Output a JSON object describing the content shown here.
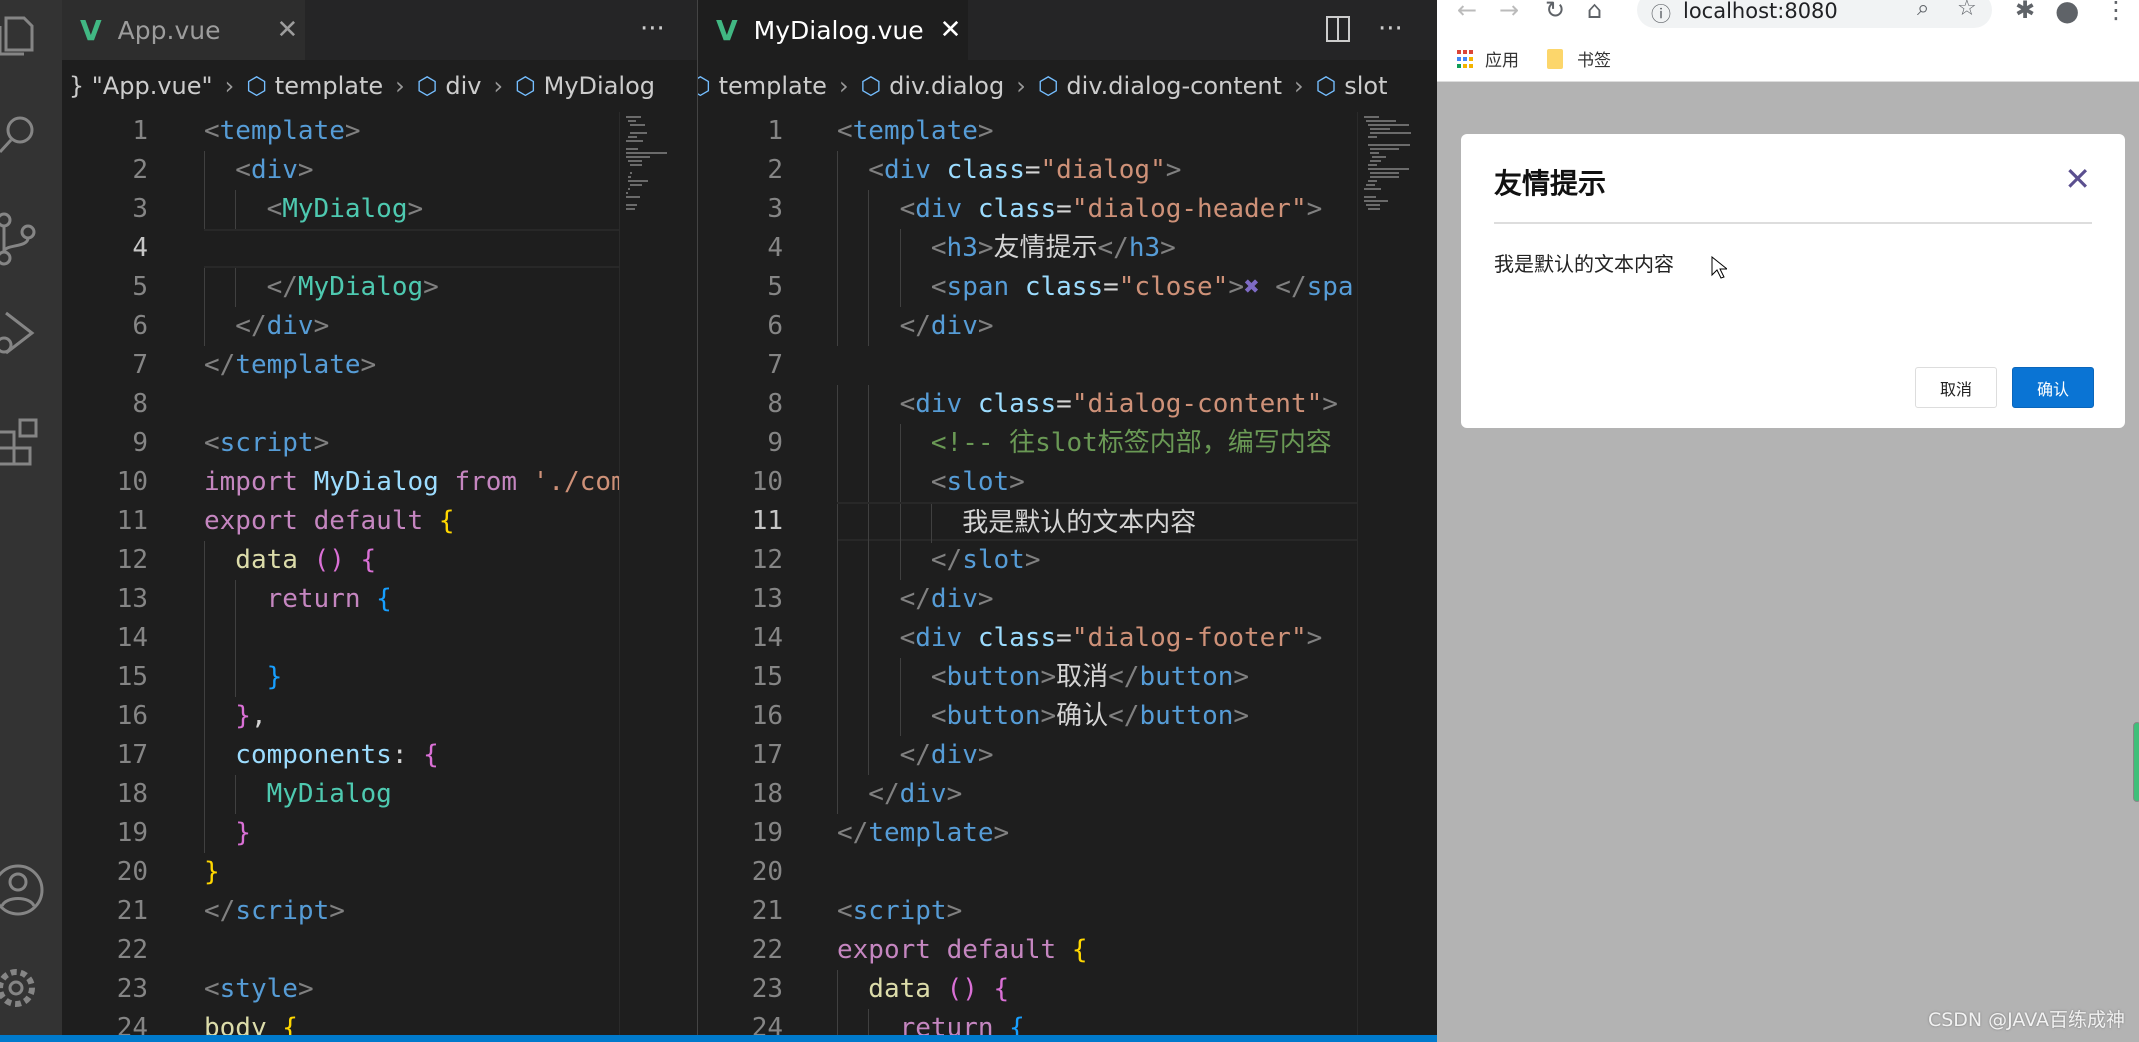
{
  "left_editor": {
    "tab": {
      "label": "App.vue",
      "close": "✕",
      "icon": "vue-icon"
    },
    "more": "···",
    "breadcrumb": [
      "{ } \"App.vue\"",
      "template",
      "div",
      "MyDialog"
    ],
    "current_line": 4,
    "lines": [
      [
        0,
        [
          [
            "p",
            "<"
          ],
          [
            "t",
            "template"
          ],
          [
            "p",
            ">"
          ]
        ]
      ],
      [
        1,
        [
          [
            "p",
            "<"
          ],
          [
            "t",
            "div"
          ],
          [
            "p",
            ">"
          ]
        ]
      ],
      [
        2,
        [
          [
            "p",
            "<"
          ],
          [
            "c",
            "MyDialog"
          ],
          [
            "p",
            ">"
          ]
        ]
      ],
      [
        0,
        []
      ],
      [
        2,
        [
          [
            "p",
            "</"
          ],
          [
            "c",
            "MyDialog"
          ],
          [
            "p",
            ">"
          ]
        ]
      ],
      [
        1,
        [
          [
            "p",
            "</"
          ],
          [
            "t",
            "div"
          ],
          [
            "p",
            ">"
          ]
        ]
      ],
      [
        0,
        [
          [
            "p",
            "</"
          ],
          [
            "t",
            "template"
          ],
          [
            "p",
            ">"
          ]
        ]
      ],
      [
        0,
        []
      ],
      [
        0,
        [
          [
            "p",
            "<"
          ],
          [
            "t",
            "script"
          ],
          [
            "p",
            ">"
          ]
        ]
      ],
      [
        0,
        [
          [
            "k",
            "import "
          ],
          [
            "v",
            "MyDialog "
          ],
          [
            "k",
            "from "
          ],
          [
            "s",
            "'./com"
          ]
        ]
      ],
      [
        0,
        [
          [
            "k",
            "export default "
          ],
          [
            "b1",
            "{"
          ]
        ]
      ],
      [
        1,
        [
          [
            "f",
            "data "
          ],
          [
            "b2",
            "() {"
          ]
        ]
      ],
      [
        2,
        [
          [
            "k",
            "return "
          ],
          [
            "b3",
            "{"
          ]
        ]
      ],
      [
        2,
        []
      ],
      [
        2,
        [
          [
            "b3",
            "}"
          ]
        ]
      ],
      [
        1,
        [
          [
            "b2",
            "}"
          ],
          [
            "x",
            ","
          ]
        ]
      ],
      [
        1,
        [
          [
            "a",
            "components"
          ],
          [
            "x",
            ": "
          ],
          [
            "b2",
            "{"
          ]
        ]
      ],
      [
        2,
        [
          [
            "c",
            "MyDialog"
          ]
        ]
      ],
      [
        1,
        [
          [
            "b2",
            "}"
          ]
        ]
      ],
      [
        0,
        [
          [
            "b1",
            "}"
          ]
        ]
      ],
      [
        0,
        [
          [
            "p",
            "</"
          ],
          [
            "t",
            "script"
          ],
          [
            "p",
            ">"
          ]
        ]
      ],
      [
        0,
        []
      ],
      [
        0,
        [
          [
            "p",
            "<"
          ],
          [
            "t",
            "style"
          ],
          [
            "p",
            ">"
          ]
        ]
      ],
      [
        0,
        [
          [
            "f",
            "body "
          ],
          [
            "b1",
            "{"
          ]
        ]
      ]
    ]
  },
  "right_editor": {
    "tab": {
      "label": "MyDialog.vue",
      "close": "✕",
      "icon": "vue-icon"
    },
    "more": "···",
    "breadcrumb": [
      "template",
      "div.dialog",
      "div.dialog-content",
      "slot"
    ],
    "current_line": 11,
    "lines": [
      [
        0,
        [
          [
            "p",
            "<"
          ],
          [
            "t",
            "template"
          ],
          [
            "p",
            ">"
          ]
        ]
      ],
      [
        1,
        [
          [
            "p",
            "<"
          ],
          [
            "t",
            "div "
          ],
          [
            "a",
            "class"
          ],
          [
            "x",
            "="
          ],
          [
            "s",
            "\"dialog\""
          ],
          [
            "p",
            ">"
          ]
        ]
      ],
      [
        2,
        [
          [
            "p",
            "<"
          ],
          [
            "t",
            "div "
          ],
          [
            "a",
            "class"
          ],
          [
            "x",
            "="
          ],
          [
            "s",
            "\"dialog-header\""
          ],
          [
            "p",
            ">"
          ]
        ]
      ],
      [
        3,
        [
          [
            "p",
            "<"
          ],
          [
            "t",
            "h3"
          ],
          [
            "p",
            ">"
          ],
          [
            "x",
            "友情提示"
          ],
          [
            "p",
            "</"
          ],
          [
            "t",
            "h3"
          ],
          [
            "p",
            ">"
          ]
        ]
      ],
      [
        3,
        [
          [
            "p",
            "<"
          ],
          [
            "t",
            "span "
          ],
          [
            "a",
            "class"
          ],
          [
            "x",
            "="
          ],
          [
            "s",
            "\"close\""
          ],
          [
            "p",
            ">"
          ],
          [
            "xx",
            "✖"
          ],
          [
            "p",
            " </"
          ],
          [
            "t",
            "spa"
          ]
        ]
      ],
      [
        2,
        [
          [
            "p",
            "</"
          ],
          [
            "t",
            "div"
          ],
          [
            "p",
            ">"
          ]
        ]
      ],
      [
        0,
        []
      ],
      [
        2,
        [
          [
            "p",
            "<"
          ],
          [
            "t",
            "div "
          ],
          [
            "a",
            "class"
          ],
          [
            "x",
            "="
          ],
          [
            "s",
            "\"dialog-content\""
          ],
          [
            "p",
            ">"
          ]
        ]
      ],
      [
        3,
        [
          [
            "m",
            "<!-- 往slot标签内部，编写内容"
          ]
        ]
      ],
      [
        3,
        [
          [
            "p",
            "<"
          ],
          [
            "t",
            "slot"
          ],
          [
            "p",
            ">"
          ]
        ]
      ],
      [
        4,
        [
          [
            "x",
            "我是默认的文本内容"
          ]
        ]
      ],
      [
        3,
        [
          [
            "p",
            "</"
          ],
          [
            "t",
            "slot"
          ],
          [
            "p",
            ">"
          ]
        ]
      ],
      [
        2,
        [
          [
            "p",
            "</"
          ],
          [
            "t",
            "div"
          ],
          [
            "p",
            ">"
          ]
        ]
      ],
      [
        2,
        [
          [
            "p",
            "<"
          ],
          [
            "t",
            "div "
          ],
          [
            "a",
            "class"
          ],
          [
            "x",
            "="
          ],
          [
            "s",
            "\"dialog-footer\""
          ],
          [
            "p",
            ">"
          ]
        ]
      ],
      [
        3,
        [
          [
            "p",
            "<"
          ],
          [
            "t",
            "button"
          ],
          [
            "p",
            ">"
          ],
          [
            "x",
            "取消"
          ],
          [
            "p",
            "</"
          ],
          [
            "t",
            "button"
          ],
          [
            "p",
            ">"
          ]
        ]
      ],
      [
        3,
        [
          [
            "p",
            "<"
          ],
          [
            "t",
            "button"
          ],
          [
            "p",
            ">"
          ],
          [
            "x",
            "确认"
          ],
          [
            "p",
            "</"
          ],
          [
            "t",
            "button"
          ],
          [
            "p",
            ">"
          ]
        ]
      ],
      [
        2,
        [
          [
            "p",
            "</"
          ],
          [
            "t",
            "div"
          ],
          [
            "p",
            ">"
          ]
        ]
      ],
      [
        1,
        [
          [
            "p",
            "</"
          ],
          [
            "t",
            "div"
          ],
          [
            "p",
            ">"
          ]
        ]
      ],
      [
        0,
        [
          [
            "p",
            "</"
          ],
          [
            "t",
            "template"
          ],
          [
            "p",
            ">"
          ]
        ]
      ],
      [
        0,
        []
      ],
      [
        0,
        [
          [
            "p",
            "<"
          ],
          [
            "t",
            "script"
          ],
          [
            "p",
            ">"
          ]
        ]
      ],
      [
        0,
        [
          [
            "k",
            "export default "
          ],
          [
            "b1",
            "{"
          ]
        ]
      ],
      [
        1,
        [
          [
            "f",
            "data "
          ],
          [
            "b2",
            "() {"
          ]
        ]
      ],
      [
        2,
        [
          [
            "k",
            "return "
          ],
          [
            "b3",
            "{"
          ]
        ]
      ]
    ]
  },
  "browser": {
    "url": "localhost:8080",
    "bookmarks": [
      {
        "label": "应用",
        "icon": "apps-grid-icon"
      },
      {
        "label": "书签",
        "icon": "folder-icon"
      }
    ],
    "dialog": {
      "title": "友情提示",
      "close": "✕",
      "content": "我是默认的文本内容",
      "cancel": "取消",
      "confirm": "确认"
    },
    "watermark": "CSDN @JAVA百练成神"
  },
  "colors": {
    "accent": "#007acc",
    "confirm_button": "#0a74d4",
    "close_icon": "#5b4f8f",
    "overlay": "#b3b3b3"
  }
}
